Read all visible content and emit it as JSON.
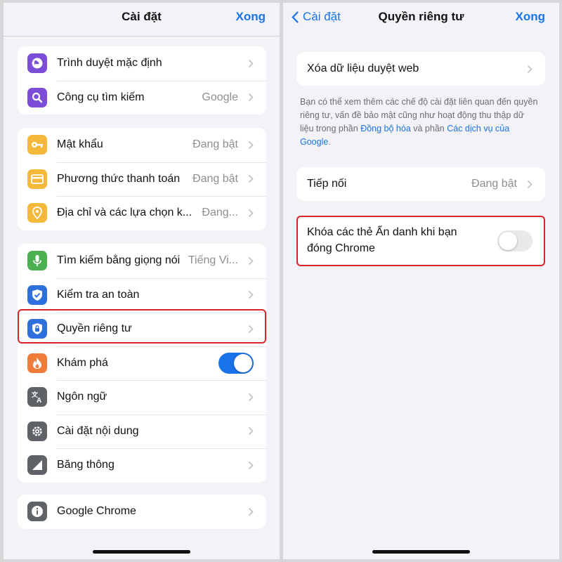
{
  "left": {
    "title": "Cài đặt",
    "done": "Xong",
    "groups": [
      [
        {
          "label": "Trình duyệt mặc định",
          "value": "",
          "icon": "globe-icon",
          "color": "#7c4dd6"
        },
        {
          "label": "Công cụ tìm kiếm",
          "value": "Google",
          "icon": "search-icon",
          "color": "#7c4dd6"
        }
      ],
      [
        {
          "label": "Mật khẩu",
          "value": "Đang bật",
          "icon": "key-icon",
          "color": "#f4b83a"
        },
        {
          "label": "Phương thức thanh toán",
          "value": "Đang bật",
          "icon": "credit-card-icon",
          "color": "#f4b83a"
        },
        {
          "label": "Địa chỉ và các lựa chọn k...",
          "value": "Đang...",
          "icon": "location-pin-icon",
          "color": "#f4b83a"
        }
      ],
      [
        {
          "label": "Tìm kiếm bằng giọng nói",
          "value": "Tiếng Vi...",
          "icon": "microphone-icon",
          "color": "#4caf50"
        },
        {
          "label": "Kiểm tra an toàn",
          "value": "",
          "icon": "shield-check-icon",
          "color": "#2f6fdc"
        },
        {
          "label": "Quyền riêng tư",
          "value": "",
          "icon": "shield-lock-icon",
          "color": "#2f6fdc"
        },
        {
          "label": "Khám phá",
          "value": "",
          "icon": "flame-icon",
          "color": "#ef7c3b",
          "toggle": true
        },
        {
          "label": "Ngôn ngữ",
          "value": "",
          "icon": "translate-icon",
          "color": "#5f6368"
        },
        {
          "label": "Cài đặt nội dung",
          "value": "",
          "icon": "gear-icon",
          "color": "#5f6368"
        },
        {
          "label": "Băng thông",
          "value": "",
          "icon": "bandwidth-icon",
          "color": "#5f6368"
        }
      ],
      [
        {
          "label": "Google Chrome",
          "value": "",
          "icon": "info-icon",
          "color": "#5f6368"
        }
      ]
    ],
    "discover_toggle_on": true
  },
  "right": {
    "back": "Cài đặt",
    "title": "Quyền riêng tư",
    "done": "Xong",
    "clear_data": "Xóa dữ liệu duyệt web",
    "note_part1": "Bạn có thể xem thêm các chế độ cài đặt liên quan đến quyền riêng tư, vấn đề bảo mật cũng như hoạt động thu thập dữ liệu trong phần ",
    "note_link1": "Đồng bộ hóa",
    "note_part2": " và phần ",
    "note_link2": "Các dịch vụ của Google",
    "note_part3": ".",
    "handoff": "Tiếp nối",
    "handoff_value": "Đang bật",
    "lock_incognito": "Khóa các thẻ Ẩn danh khi bạn đóng Chrome",
    "lock_toggle_on": false
  },
  "colors": {
    "accent": "#1a73e8",
    "highlight": "#d9252a",
    "toggle_on": "#1a73e8",
    "toggle_off": "#e9e9eb"
  }
}
